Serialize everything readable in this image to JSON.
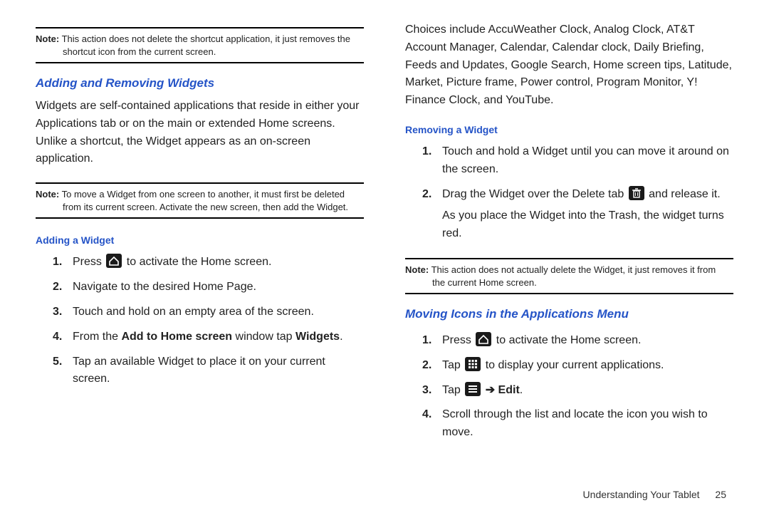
{
  "col1": {
    "note1": {
      "label": "Note:",
      "line1": "This action does not delete the shortcut application, it just removes the",
      "line2": "shortcut icon from the current screen."
    },
    "sec1_title": "Adding and Removing Widgets",
    "sec1_para": "Widgets are self-contained applications that reside in either your Applications tab or on the main or extended Home screens. Unlike a shortcut, the Widget appears as an on-screen application.",
    "note2": {
      "label": "Note:",
      "line1": "To move a Widget from one screen to another, it must first be deleted",
      "line2": "from its current screen. Activate the new screen, then add the Widget."
    },
    "sub1_title": "Adding a Widget",
    "steps1": {
      "s1a": "Press ",
      "s1b": " to activate the Home screen.",
      "s2": "Navigate to the desired Home Page.",
      "s3": "Touch and hold on an empty area of the screen.",
      "s4a": "From the ",
      "s4b": "Add to Home screen",
      "s4c": " window tap ",
      "s4d": "Widgets",
      "s4e": ".",
      "s5": "Tap an available Widget to place it on your current screen."
    }
  },
  "col2": {
    "para1": "Choices include AccuWeather Clock, Analog Clock, AT&T Account Manager, Calendar, Calendar clock, Daily Briefing, Feeds and Updates, Google Search, Home screen tips, Latitude, Market, Picture frame, Power control, Program Monitor, Y! Finance Clock, and YouTube.",
    "sub2_title": "Removing a Widget",
    "steps2": {
      "s1": "Touch and hold a Widget until you can move it around on the screen.",
      "s2a": "Drag the Widget over the Delete tab ",
      "s2b": " and release it.",
      "s2c": "As you place the Widget into the Trash, the widget turns red."
    },
    "note3": {
      "label": "Note:",
      "line1": "This action does not actually delete the Widget, it just removes it from",
      "line2": "the current Home screen."
    },
    "sec2_title": "Moving Icons in the Applications Menu",
    "steps3": {
      "s1a": "Press ",
      "s1b": " to activate the Home screen.",
      "s2a": "Tap ",
      "s2b": " to display your current applications.",
      "s3a": "Tap ",
      "s3b": " ",
      "s3c": "➔",
      "s3d": " Edit",
      "s3e": ".",
      "s4": "Scroll through the list and locate the icon you wish to move."
    }
  },
  "footer": {
    "text": "Understanding Your Tablet",
    "page": "25"
  }
}
